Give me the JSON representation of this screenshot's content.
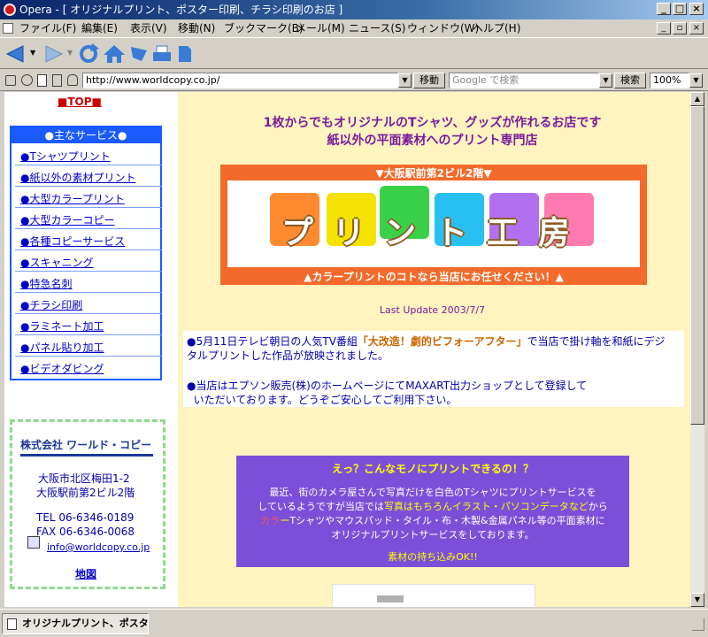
{
  "window": {
    "title": "Opera - [ オリジナルプリント、ポスター印刷、チラシ印刷のお店 ]"
  },
  "menu": [
    "ファイル(F)",
    "編集(E)",
    "表示(V)",
    "移動(N)",
    "ブックマーク(B)",
    "メール(M)",
    "ニュース(S)",
    "ウィンドウ(W)",
    "ヘルプ(H)"
  ],
  "address": {
    "url": "http://www.worldcopy.co.jp/",
    "go_label": "移動",
    "search_placeholder": "Google で検索",
    "search_label": "検索",
    "zoom": "100%"
  },
  "sidebar": {
    "top_link": "■TOP■",
    "services_title": "●主なサービス●",
    "items": [
      "●Tシャツプリント",
      "●紙以外の素材プリント",
      "●大型カラープリント",
      "●大型カラーコピー",
      "●各種コピーサービス",
      "●スキャニング",
      "●特急名刺",
      "●チラシ印刷",
      "●ラミネート加工",
      "●パネル貼り加工",
      "●ビデオダビング"
    ],
    "company_logo": "株式会社 ワールド・コピー",
    "address1": "大阪市北区梅田1-2",
    "address2": "大阪駅前第2ビル2階",
    "tel": "TEL 06-6346-0189",
    "fax": "FAX 06-6346-0068",
    "email": "info@worldcopy.co.jp",
    "map_link": "地図"
  },
  "main": {
    "headline1": "1枚からでもオリジナルのTシャツ、グッズが作れるお店です",
    "headline2": "紙以外の平面素材へのプリント専門店",
    "banner_top": "▼大阪駅前第2ビル2階▼",
    "banner_logo": "プリント工房",
    "banner_bottom": "▲カラープリントのコトなら当店にお任せください！▲",
    "last_update": "Last Update 2003/7/7",
    "news1_a": "●5月11日テレビ朝日の人気TV番組",
    "news1_b": "「大改造！劇的ビフォーアフター」",
    "news1_c": "で当店で掛け軸を和紙にデジ",
    "news1_d": "タルプリントした作品が放映されました。",
    "news2_a": "●当店はエプソン販売(株)のホームページにてMAXART出力ショップとして登録して",
    "news2_b": "いただいております。どうぞご安心してご利用下さい。",
    "promo_title": "えっ？こんなモノにプリントできるの！？",
    "promo_l1": "最近、街のカメラ屋さんで写真だけを白色のTシャツにプリントサービスを",
    "promo_l2a": "しているようですが当店では",
    "promo_l2b": "写真はもちろんイラスト・パソコンデータなど",
    "promo_l2c": "から",
    "promo_l3a": "カラ",
    "promo_l3b": "ー",
    "promo_l3c": "Tシャツやマウスパッド・タイル・布・木製&金属パネル等の平面素材に",
    "promo_l4": "オリジナルプリントサービスをしております。",
    "promo_l5": "素材の持ち込みOK!!"
  },
  "status": {
    "tab_label": "オリジナルプリント、ポスタ..."
  },
  "colors": {
    "accent_purple": "#7d4fd8",
    "banner_orange": "#f36a2a",
    "page_bg": "#fff4c0",
    "headline": "#7a1a9a"
  }
}
